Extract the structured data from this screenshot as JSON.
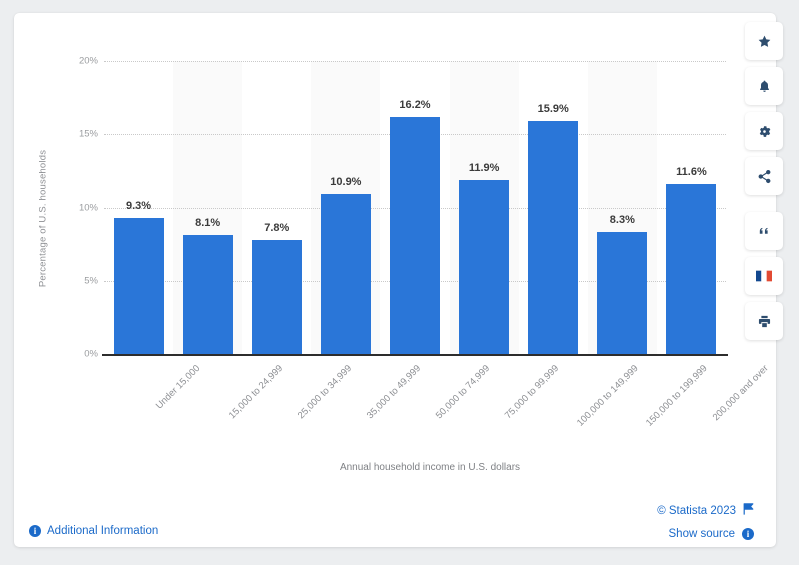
{
  "chart_data": {
    "type": "bar",
    "title": "",
    "xlabel": "Annual household income in U.S. dollars",
    "ylabel": "Percentage of U.S. households",
    "categories": [
      "Under 15,000",
      "15,000 to 24,999",
      "25,000 to 34,999",
      "35,000 to 49,999",
      "50,000 to 74,999",
      "75,000 to 99,999",
      "100,000 to 149,999",
      "150,000 to 199,999",
      "200,000 and over"
    ],
    "values": [
      9.3,
      8.1,
      7.8,
      10.9,
      16.2,
      11.9,
      15.9,
      8.3,
      11.6
    ],
    "value_labels": [
      "9.3%",
      "8.1%",
      "7.8%",
      "10.9%",
      "16.2%",
      "11.9%",
      "15.9%",
      "8.3%",
      "11.6%"
    ],
    "ylim": [
      0,
      20
    ],
    "ytick_labels": [
      "20%",
      "15%",
      "10%",
      "5%",
      "0%"
    ],
    "ytick_values": [
      20,
      15,
      10,
      5,
      0
    ],
    "grid": true,
    "legend": "none",
    "bar_color": "#2a76d8"
  },
  "footer": {
    "additional_information": "Additional Information",
    "copyright": "© Statista 2023",
    "show_source": "Show source",
    "info_glyph": "i"
  },
  "toolbar": {
    "items": [
      {
        "name": "favorite-icon",
        "title": "Add to favorites"
      },
      {
        "name": "notification-bell-icon",
        "title": "Notifications"
      },
      {
        "name": "settings-gear-icon",
        "title": "Settings"
      },
      {
        "name": "share-icon",
        "title": "Share"
      },
      {
        "name": "citation-quote-icon",
        "title": "Cite"
      },
      {
        "name": "french-flag-icon",
        "title": "French version"
      },
      {
        "name": "print-icon",
        "title": "Print"
      }
    ]
  },
  "colors": {
    "accent": "#2a76d8",
    "link": "#1b6ac9",
    "axis": "#2d2d2d",
    "band": "#fafafa",
    "page_bg": "#eceef0",
    "card_bg": "#ffffff",
    "toolbar_icon": "#2e4d6e"
  }
}
